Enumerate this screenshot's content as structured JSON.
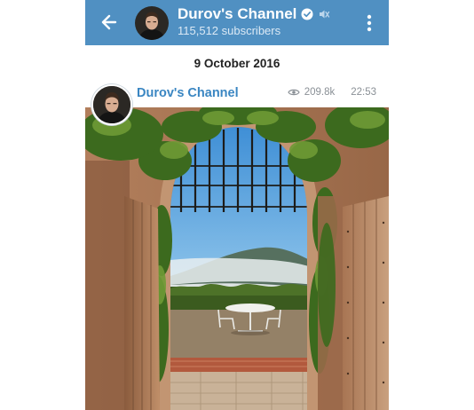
{
  "header": {
    "title": "Durov's Channel",
    "subscribers": "115,512 subscribers",
    "back_icon": "arrow-left-icon",
    "verified_icon": "verified-check-icon",
    "mute_icon": "muted-speaker-icon",
    "menu_icon": "more-vertical-icon",
    "color": "#5090c2"
  },
  "date_separator": "9 October 2016",
  "post": {
    "author": "Durov's Channel",
    "views": "209.8k",
    "time": "22:53",
    "views_icon": "eye-icon",
    "author_color": "#3a86c2"
  }
}
